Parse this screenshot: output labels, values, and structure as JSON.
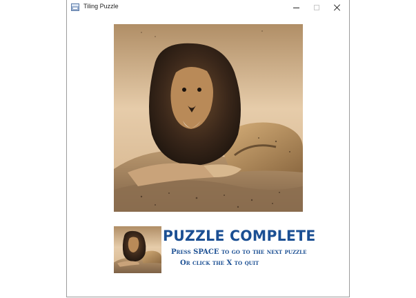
{
  "window": {
    "title": "Tiling Puzzle",
    "controls": {
      "minimize": "minimize-icon",
      "maximize": "maximize-icon",
      "close": "close-icon"
    }
  },
  "puzzle": {
    "image_subject": "lion",
    "status_title": "PUZZLE COMPLETE",
    "hint_next": "Press SPACE to go to the next puzzle",
    "hint_quit": "Or click the X to quit"
  },
  "colors": {
    "accent": "#1b4f93",
    "sky_light": "#e9cfa8",
    "sky_dark": "#a9855c",
    "mane_dark": "#2a1c12",
    "fur": "#b88a55",
    "rock": "#9a7b57"
  }
}
